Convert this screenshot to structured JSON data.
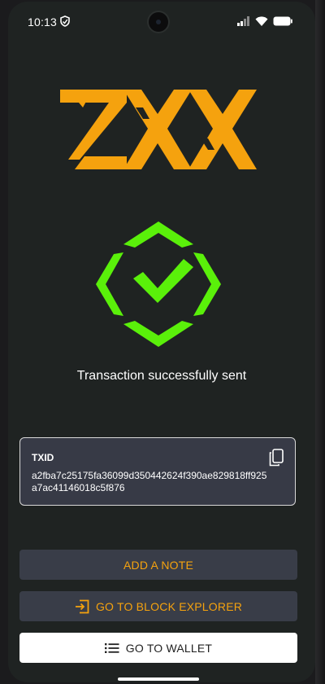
{
  "status_bar": {
    "time": "10:13"
  },
  "message": {
    "success": "Transaction successfully sent"
  },
  "txid": {
    "label": "TXID",
    "value": "a2fba7c25175fa36099d350442624f390ae829818ff925a7ac41146018c5f876"
  },
  "buttons": {
    "add_note": "ADD A NOTE",
    "block_explorer": "GO TO BLOCK EXPLORER",
    "wallet": "GO TO WALLET"
  },
  "colors": {
    "background": "#1f2322",
    "brand_orange": "#f5a20e",
    "success_green": "#5af00a",
    "card_background": "#373a46",
    "button_background": "#393d48"
  },
  "icons": {
    "status": [
      "shield-icon",
      "signal-icon",
      "wifi-icon",
      "battery-icon"
    ],
    "copy": "copy-icon",
    "explorer": "open-external-icon",
    "wallet": "list-icon",
    "success": "checkmark-icon"
  }
}
